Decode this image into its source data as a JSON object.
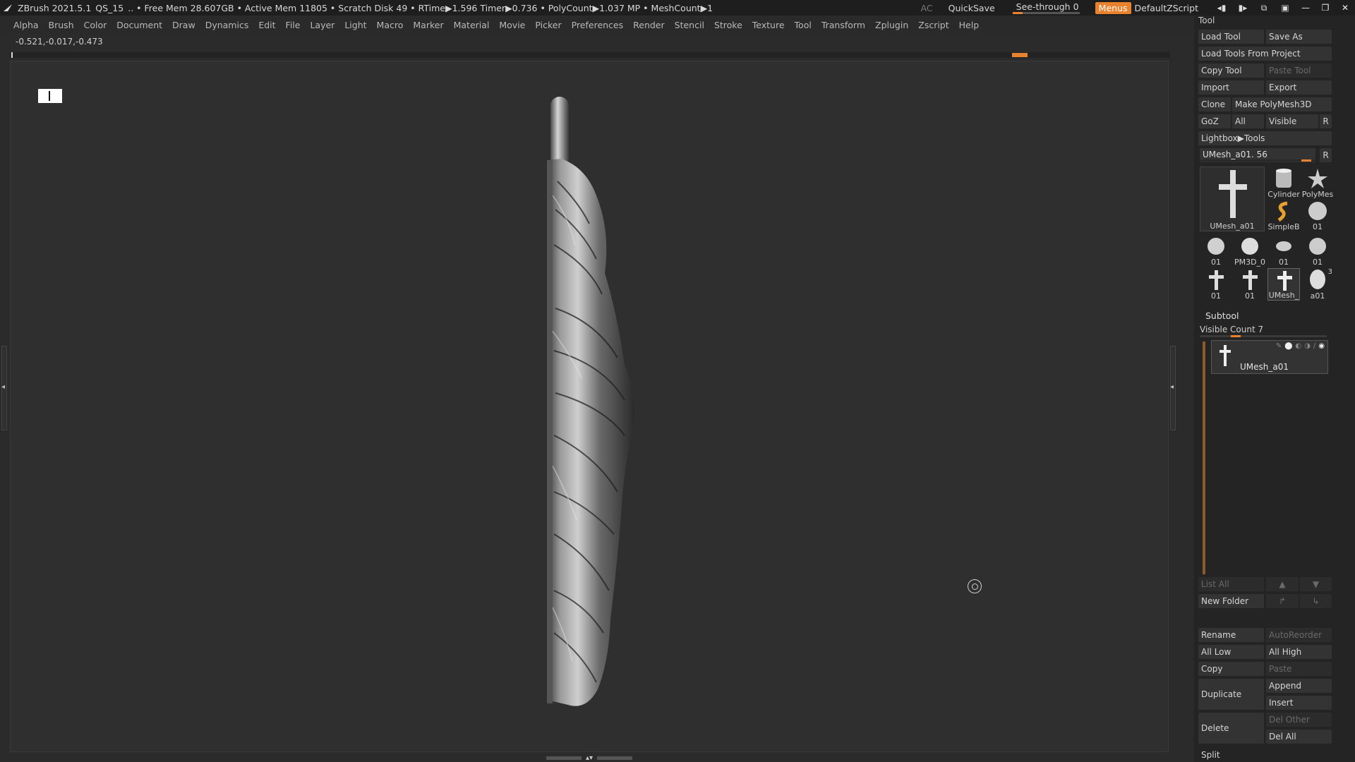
{
  "titlebar": {
    "app": "ZBrush 2021.5.1",
    "project": "QS_15",
    "stats": ".. • Free Mem 28.607GB • Active Mem 11805 • Scratch Disk 49 •  RTime▶1.596 Timer▶0.736 • PolyCount▶1.037 MP  • MeshCount▶1",
    "ac": "AC",
    "quicksave": "QuickSave",
    "seethrough": "See-through  0",
    "seethrough_value": 0,
    "menus": "Menus",
    "script": "DefaultZScript"
  },
  "menubar": [
    "Alpha",
    "Brush",
    "Color",
    "Document",
    "Draw",
    "Dynamics",
    "Edit",
    "File",
    "Layer",
    "Light",
    "Macro",
    "Marker",
    "Material",
    "Movie",
    "Picker",
    "Preferences",
    "Render",
    "Stencil",
    "Stroke",
    "Texture",
    "Tool",
    "Transform",
    "Zplugin",
    "Zscript",
    "Help"
  ],
  "viewport": {
    "coords": "-0.521,-0.017,-0.473"
  },
  "tool": {
    "title": "Tool",
    "buttons": {
      "load_tool": "Load Tool",
      "save_as": "Save As",
      "load_from_project": "Load Tools From Project",
      "copy_tool": "Copy Tool",
      "paste_tool": "Paste Tool",
      "import": "Import",
      "export": "Export",
      "clone": "Clone",
      "make_polymesh": "Make PolyMesh3D",
      "goz": "GoZ",
      "all": "All",
      "visible": "Visible",
      "r": "R",
      "lightbox_tools": "Lightbox▶Tools"
    },
    "current_tool": "UMesh_a01. 56",
    "thumbs": [
      {
        "label": "UMesh_a01"
      },
      {
        "label": "Cylinder"
      },
      {
        "label": "PolyMes"
      },
      {
        "label": "SimpleB"
      },
      {
        "label": "01"
      },
      {
        "label": "01"
      },
      {
        "label": "PM3D_0"
      },
      {
        "label": "01"
      },
      {
        "label": "01"
      },
      {
        "label": "01"
      },
      {
        "label": "01"
      },
      {
        "label": "UMesh_"
      },
      {
        "label": "a01"
      }
    ],
    "thumb_badge": "3"
  },
  "subtool": {
    "title": "Subtool",
    "visible_count": "Visible Count 7",
    "item_name": "UMesh_a01",
    "buttons": {
      "list_all": "List All",
      "new_folder": "New Folder",
      "rename": "Rename",
      "autoreorder": "AutoReorder",
      "all_low": "All Low",
      "all_high": "All High",
      "copy": "Copy",
      "paste": "Paste",
      "duplicate": "Duplicate",
      "append": "Append",
      "insert": "Insert",
      "delete": "Delete",
      "del_other": "Del Other",
      "del_all": "Del All",
      "split": "Split"
    }
  },
  "colors": {
    "accent": "#e8822e",
    "panel": "#242424",
    "viewport": "#2f2f2f"
  }
}
